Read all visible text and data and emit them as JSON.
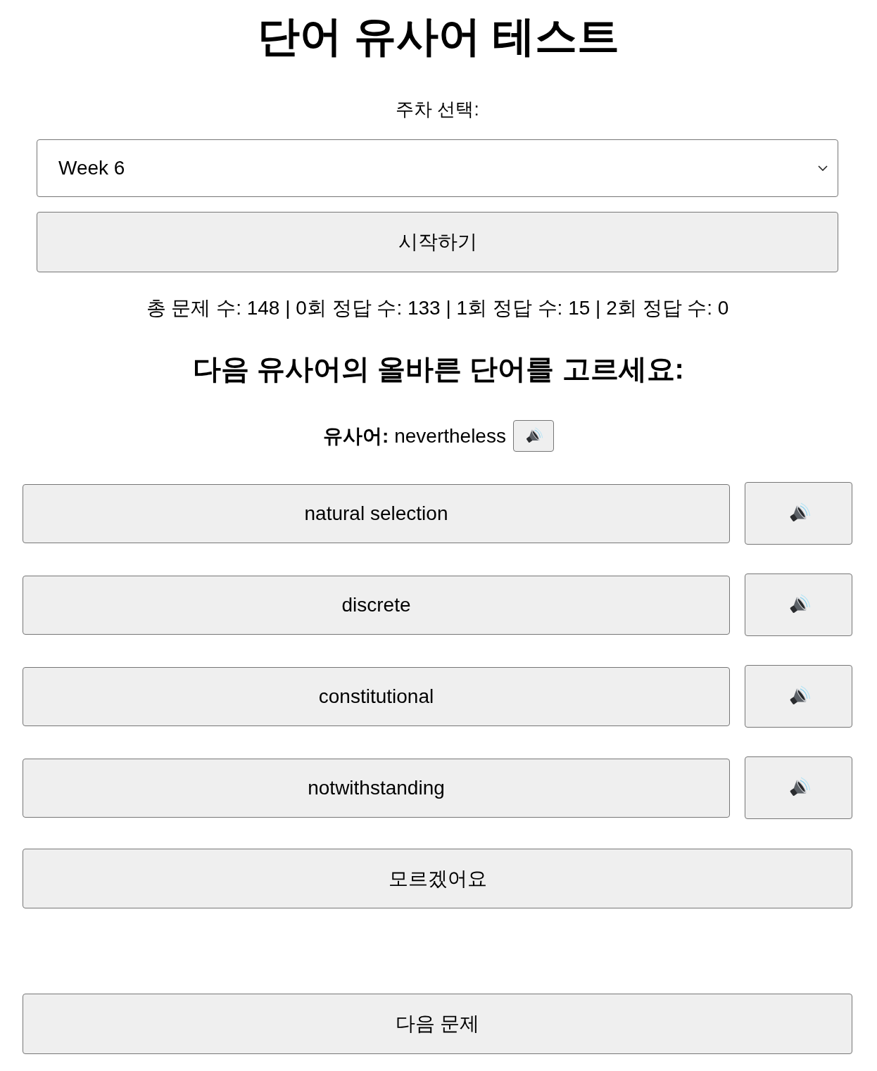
{
  "title": "단어 유사어 테스트",
  "week_select": {
    "label": "주차 선택:",
    "value": "Week 6"
  },
  "start_button": "시작하기",
  "stats": "총 문제 수: 148 | 0회 정답 수: 133 | 1회 정답 수: 15 | 2회 정답 수: 0",
  "question": {
    "heading": "다음 유사어의 올바른 단어를 고르세요:",
    "synonym_line": "**유사어:** nevertheless"
  },
  "options": [
    {
      "label": "natural selection"
    },
    {
      "label": "discrete"
    },
    {
      "label": "constitutional"
    },
    {
      "label": "notwithstanding"
    }
  ],
  "dont_know_button": "모르겠어요",
  "next_button": "다음 문제"
}
